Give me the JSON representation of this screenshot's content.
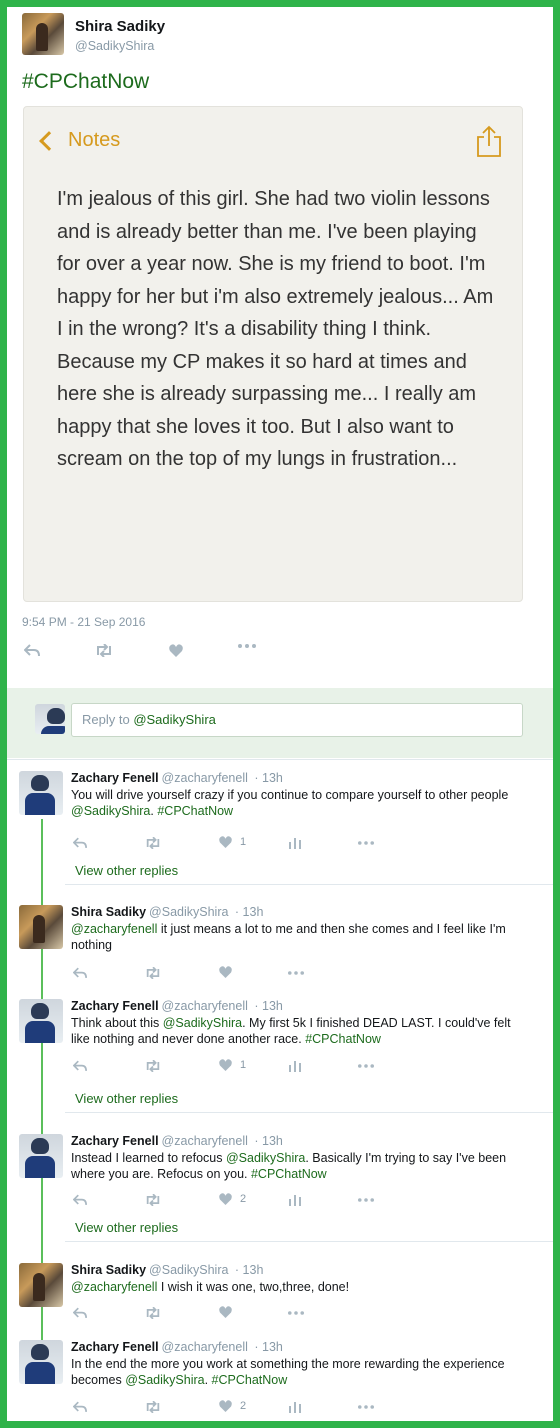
{
  "main_tweet": {
    "name": "Shira Sadiky",
    "handle": "@SadikyShira",
    "hashtag_text": "#CPChatNow",
    "notes": {
      "back_label": "Notes",
      "body": "I'm jealous of this girl. She had two violin lessons and is already better than me. I've been playing for over a year now. She is my friend to boot. I'm happy for her but i'm also extremely jealous... Am I in the wrong? It's a disability thing I think. Because my CP makes it so hard at times and here she is already surpassing me... I really am happy that she loves it too. But I also want to scream on the top of my lungs in frustration..."
    },
    "timestamp": "9:54 PM - 21 Sep 2016"
  },
  "reply_box": {
    "prefix": "Reply to ",
    "mention": "@SadikyShira"
  },
  "replies": [
    {
      "name": "Zachary Fenell",
      "handle": "@zacharyfenell",
      "time": "· 13h",
      "text_1": "You will drive yourself crazy if you continue to compare yourself to other people ",
      "link_1": "@SadikyShira",
      "text_2": ". ",
      "link_2": "#CPChatNow",
      "likes": "1",
      "view_replies": "View other replies"
    },
    {
      "name": "Shira Sadiky",
      "handle": "@SadikyShira",
      "time": "· 13h",
      "link_1": "@zacharyfenell",
      "text_1": " it just means a lot to me and then she comes and I feel like I'm nothing"
    },
    {
      "name": "Zachary Fenell",
      "handle": "@zacharyfenell",
      "time": "· 13h",
      "text_1": "Think about this ",
      "link_1": "@SadikyShira",
      "text_2": ". My first 5k I finished DEAD LAST. I could've felt like nothing and never done another race. ",
      "link_2": "#CPChatNow",
      "likes": "1",
      "view_replies": "View other replies"
    },
    {
      "name": "Zachary Fenell",
      "handle": "@zacharyfenell",
      "time": "· 13h",
      "text_1": "Instead I learned to refocus ",
      "link_1": "@SadikyShira",
      "text_2": ". Basically I'm trying to say I've been where you are. Refocus on you. ",
      "link_2": "#CPChatNow",
      "likes": "2",
      "view_replies": "View other replies"
    },
    {
      "name": "Shira Sadiky",
      "handle": "@SadikyShira",
      "time": "· 13h",
      "link_1": "@zacharyfenell",
      "text_1": " I wish it was one, two,three, done!"
    },
    {
      "name": "Zachary Fenell",
      "handle": "@zacharyfenell",
      "time": "· 13h",
      "text_1": "In the end the more you work at something the more rewarding the experience becomes ",
      "link_1": "@SadikyShira",
      "text_2": ". ",
      "link_2": "#CPChatNow",
      "likes": "2"
    }
  ],
  "colors": {
    "frame_green": "#2fb34a",
    "link_green": "#1d6b1d",
    "notes_accent": "#d69a1e",
    "icon_gray": "#aab8c2"
  }
}
